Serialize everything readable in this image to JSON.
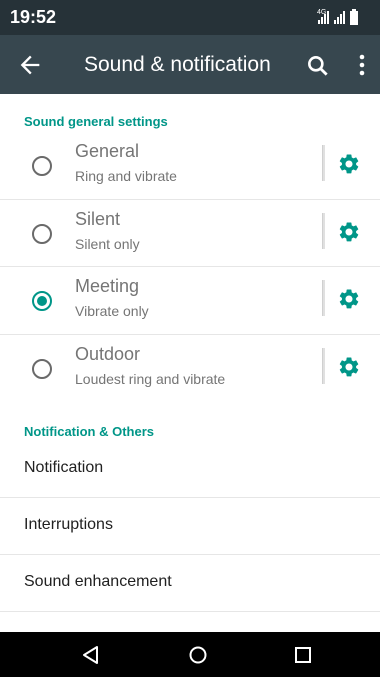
{
  "status_bar": {
    "time": "19:52",
    "network": "4G"
  },
  "app_bar": {
    "title": "Sound & notification"
  },
  "sections": {
    "general": {
      "header": "Sound general settings"
    },
    "others": {
      "header": "Notification & Others"
    }
  },
  "profiles": [
    {
      "title": "General",
      "subtitle": "Ring and vibrate",
      "selected": false
    },
    {
      "title": "Silent",
      "subtitle": "Silent only",
      "selected": false
    },
    {
      "title": "Meeting",
      "subtitle": "Vibrate only",
      "selected": true
    },
    {
      "title": "Outdoor",
      "subtitle": "Loudest ring and vibrate",
      "selected": false
    }
  ],
  "others": [
    {
      "label": "Notification"
    },
    {
      "label": "Interruptions"
    },
    {
      "label": "Sound enhancement"
    }
  ],
  "colors": {
    "accent": "#009688",
    "app_bar": "#37474F",
    "status_bar": "#263238"
  },
  "icons": [
    "back-arrow-icon",
    "search-icon",
    "more-vert-icon",
    "gear-icon",
    "nav-back-icon",
    "nav-home-icon",
    "nav-recents-icon"
  ]
}
